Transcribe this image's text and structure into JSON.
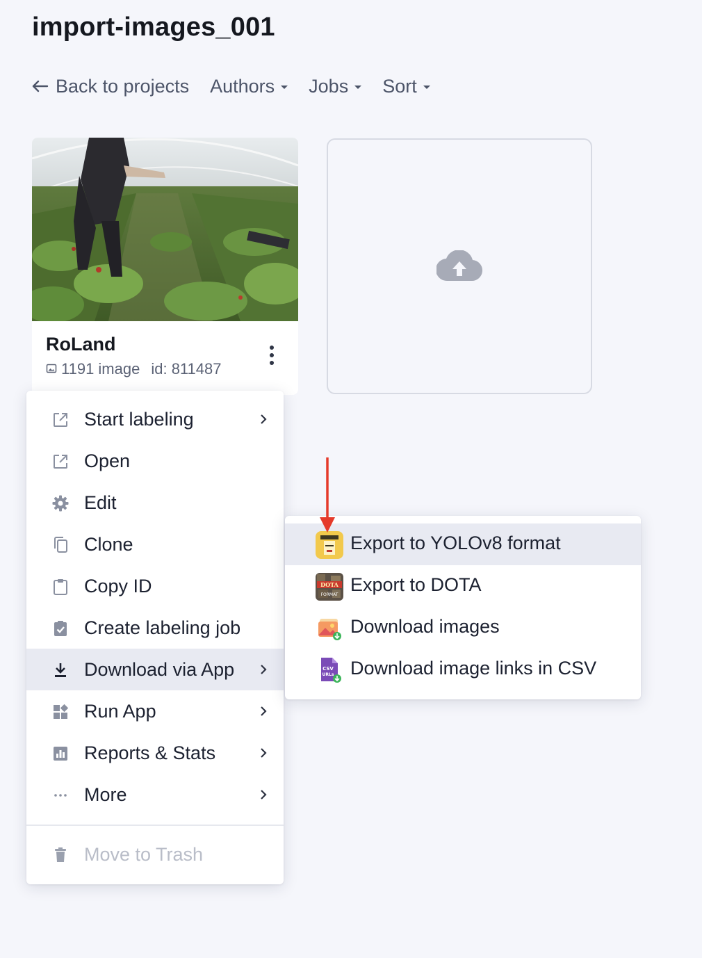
{
  "header": {
    "title": "import-images_001"
  },
  "nav": {
    "back_label": "Back to projects",
    "authors_label": "Authors",
    "jobs_label": "Jobs",
    "sort_label": "Sort"
  },
  "card": {
    "name": "RoLand",
    "image_count": "1191 image",
    "id_text": "id: 811487"
  },
  "menu": {
    "items": [
      {
        "label": "Start labeling",
        "icon": "external-link-icon",
        "has_submenu": true
      },
      {
        "label": "Open",
        "icon": "external-link-icon",
        "has_submenu": false
      },
      {
        "label": "Edit",
        "icon": "gear-icon",
        "has_submenu": false
      },
      {
        "label": "Clone",
        "icon": "copy-icon",
        "has_submenu": false
      },
      {
        "label": "Copy ID",
        "icon": "clipboard-icon",
        "has_submenu": false
      },
      {
        "label": "Create labeling job",
        "icon": "clipboard-check-icon",
        "has_submenu": false
      },
      {
        "label": "Download via App",
        "icon": "download-icon",
        "has_submenu": true,
        "active": true
      },
      {
        "label": "Run App",
        "icon": "apps-icon",
        "has_submenu": true
      },
      {
        "label": "Reports & Stats",
        "icon": "chart-icon",
        "has_submenu": true
      },
      {
        "label": "More",
        "icon": "ellipsis-icon",
        "has_submenu": true
      }
    ],
    "trash_label": "Move to Trash"
  },
  "submenu": {
    "items": [
      {
        "label": "Export to YOLOv8 format",
        "icon": "yolo-app-icon",
        "active": true
      },
      {
        "label": "Export to DOTA",
        "icon": "dota-app-icon"
      },
      {
        "label": "Download images",
        "icon": "images-download-icon"
      },
      {
        "label": "Download image links in CSV",
        "icon": "csv-download-icon"
      }
    ]
  },
  "colors": {
    "background": "#f5f6fb",
    "active_row": "#e8eaf2",
    "annotation_arrow": "#e53a2a",
    "text_muted": "#4c5468"
  }
}
